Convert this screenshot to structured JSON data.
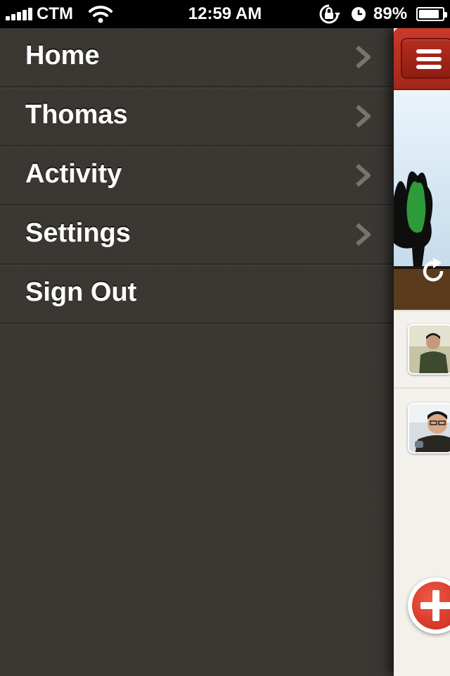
{
  "status_bar": {
    "carrier": "CTM",
    "time": "12:59 AM",
    "battery_percent": "89",
    "battery_suffix": "%",
    "battery_level": 0.89,
    "icons": [
      "signal-bars-icon",
      "wifi-icon",
      "orientation-lock-icon",
      "alarm-clock-icon",
      "battery-icon"
    ]
  },
  "menu": {
    "items": [
      {
        "label": "Home",
        "has_chevron": true
      },
      {
        "label": "Thomas",
        "has_chevron": true
      },
      {
        "label": "Activity",
        "has_chevron": true
      },
      {
        "label": "Settings",
        "has_chevron": true
      },
      {
        "label": "Sign Out",
        "has_chevron": false
      }
    ]
  },
  "main_panel": {
    "icons": [
      "hamburger-menu-icon",
      "refresh-icon",
      "add-plus-icon"
    ]
  },
  "colors": {
    "menu_background": "#3a3733",
    "nav_red": "#b52d1f",
    "add_button_red": "#d93a28",
    "feed_background": "#f3f1ec"
  }
}
